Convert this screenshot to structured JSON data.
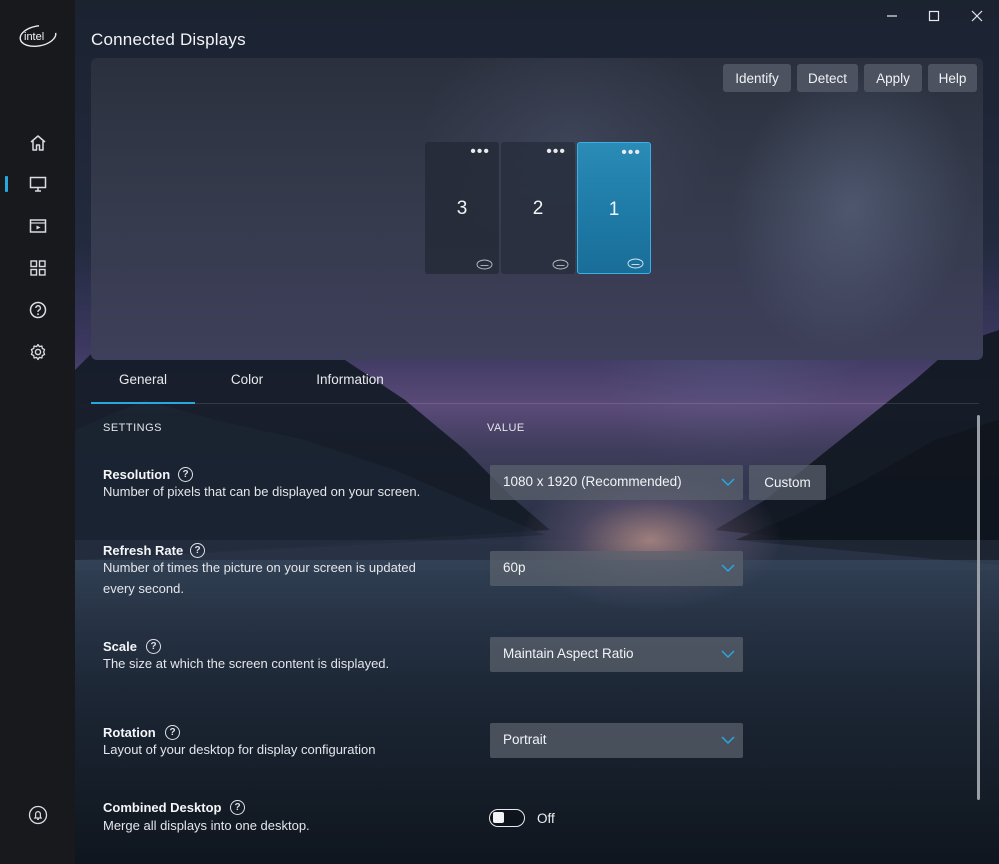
{
  "app": {
    "logo_text": "intel"
  },
  "window": {
    "minimize_icon": "minimize-icon",
    "maximize_icon": "maximize-icon",
    "close_icon": "close-icon"
  },
  "sidebar": {
    "items": [
      {
        "name": "home",
        "icon": "home-icon"
      },
      {
        "name": "display",
        "icon": "monitor-icon",
        "active": true
      },
      {
        "name": "video",
        "icon": "video-icon"
      },
      {
        "name": "apps",
        "icon": "apps-grid-icon"
      },
      {
        "name": "support",
        "icon": "help-circle-icon"
      },
      {
        "name": "system",
        "icon": "gear-icon"
      }
    ],
    "bottom_icon": "bell-icon"
  },
  "page": {
    "title": "Connected Displays"
  },
  "toolbar": {
    "identify": "Identify",
    "detect": "Detect",
    "apply": "Apply",
    "help": "Help"
  },
  "displays": [
    {
      "number": "3",
      "selected": false,
      "more": "•••"
    },
    {
      "number": "2",
      "selected": false,
      "more": "•••"
    },
    {
      "number": "1",
      "selected": true,
      "more": "•••"
    }
  ],
  "tabs": [
    {
      "label": "General",
      "active": true
    },
    {
      "label": "Color",
      "active": false
    },
    {
      "label": "Information",
      "active": false
    }
  ],
  "columns": {
    "settings": "SETTINGS",
    "value": "VALUE"
  },
  "settings": {
    "resolution": {
      "title": "Resolution",
      "description": "Number of pixels that can be displayed on your screen.",
      "value": "1080 x 1920 (Recommended)",
      "custom_label": "Custom"
    },
    "refresh_rate": {
      "title": "Refresh Rate",
      "description": "Number of times the picture on your screen is updated every second.",
      "value": "60p"
    },
    "scale": {
      "title": "Scale",
      "description": "The size at which the screen content is displayed.",
      "value": "Maintain Aspect Ratio"
    },
    "rotation": {
      "title": "Rotation",
      "description": "Layout of your desktop for display configuration",
      "value": "Portrait"
    },
    "combined_desktop": {
      "title": "Combined Desktop",
      "description": "Merge all displays into one desktop.",
      "state": "Off",
      "enabled": false
    }
  },
  "help_glyph": "?",
  "colors": {
    "accent": "#2aa7e0",
    "sidebar": "#17191d",
    "selected_display": "#1f8ec0"
  }
}
